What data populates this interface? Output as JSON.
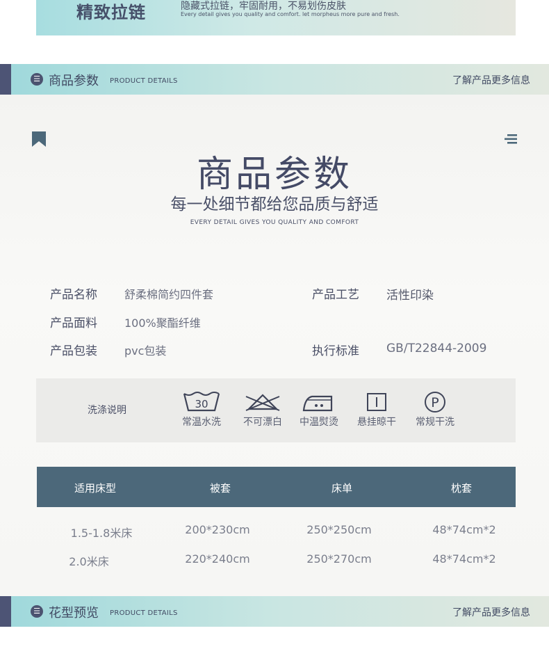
{
  "top_banner": {
    "title": "精致拉链",
    "subtitle": "隐藏式拉链，牢固耐用，不易划伤皮肤",
    "subtitle_en": "Every detail gives you quality and comfort. let morpheus more pure and fresh."
  },
  "section1": {
    "title": "商品参数",
    "title_en": "PRODUCT DETAILS",
    "more": "了解产品更多信息"
  },
  "hero": {
    "title": "商品参数",
    "subtitle": "每一处细节都给您品质与舒适",
    "subtitle_en": "EVERY DETAIL GIVES YOU QUALITY AND COMFORT"
  },
  "specs": {
    "name_label": "产品名称",
    "name_value": "舒柔棉简约四件套",
    "craft_label": "产品工艺",
    "craft_value": "活性印染",
    "fabric_label": "产品面料",
    "fabric_value": "100%聚酯纤维",
    "package_label": "产品包装",
    "package_value": "pvc包装",
    "standard_label": "执行标准",
    "standard_value": "GB/T22844-2009"
  },
  "wash": {
    "label": "洗涤说明",
    "items": [
      {
        "icon": "wash-30-icon",
        "symbol": "30",
        "label": "常温水洗"
      },
      {
        "icon": "no-bleach-icon",
        "label": "不可漂白"
      },
      {
        "icon": "iron-medium-icon",
        "label": "中温熨烫"
      },
      {
        "icon": "hang-dry-icon",
        "label": "悬挂晾干"
      },
      {
        "icon": "dry-clean-p-icon",
        "symbol": "P",
        "label": "常规干洗"
      }
    ]
  },
  "size_table": {
    "headers": [
      "适用床型",
      "被套",
      "床单",
      "枕套"
    ],
    "rows": [
      [
        "1.5-1.8米床",
        "200*230cm",
        "250*250cm",
        "48*74cm*2"
      ],
      [
        "2.0米床",
        "220*240cm",
        "250*270cm",
        "48*74cm*2"
      ]
    ]
  },
  "section2": {
    "title": "花型预览",
    "title_en": "PRODUCT DETAILS",
    "more": "了解产品更多信息"
  },
  "colors": {
    "navy": "#4c5372",
    "table_header": "#4c687a",
    "teal_gradient_start": "#9ed8db"
  }
}
